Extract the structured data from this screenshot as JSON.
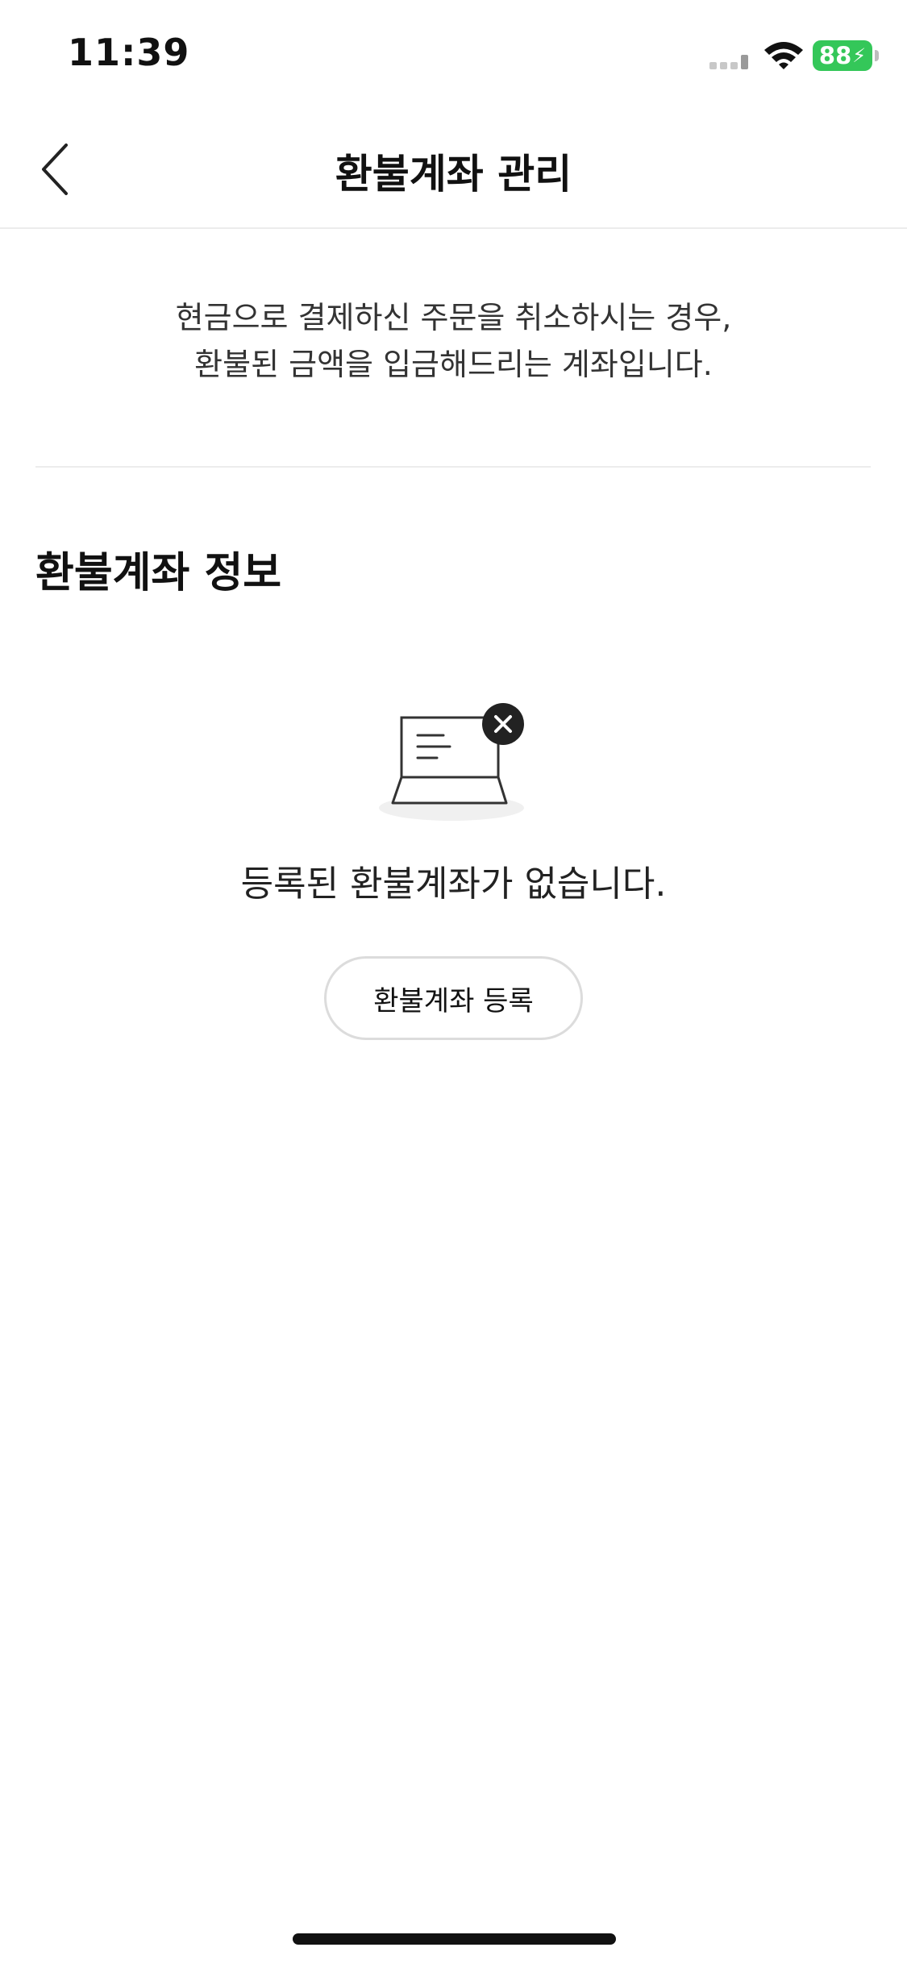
{
  "status_bar": {
    "time": "11:39",
    "battery_level": "88",
    "battery_charging": true,
    "battery_color": "#34c759"
  },
  "nav": {
    "title": "환불계좌 관리",
    "back_icon": "chevron-left-icon"
  },
  "notice": {
    "line1": "현금으로 결제하신 주문을 취소하시는 경우,",
    "line2": "환불된 금액을 입금해드리는 계좌입니다."
  },
  "section": {
    "title": "환불계좌 정보"
  },
  "empty_state": {
    "icon": "laptop-close-icon",
    "message": "등록된 환불계좌가 없습니다.",
    "button_label": "환불계좌 등록"
  }
}
